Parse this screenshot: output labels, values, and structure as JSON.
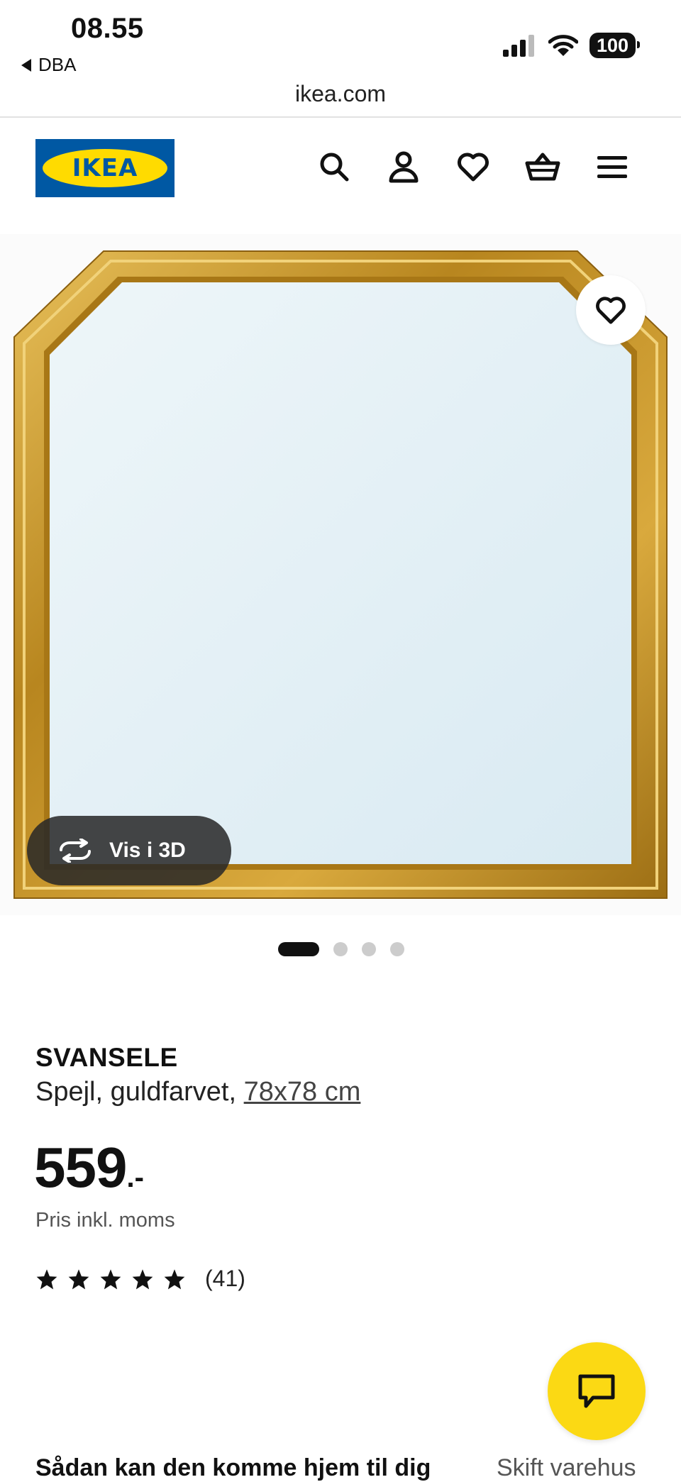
{
  "status_bar": {
    "time": "08.55",
    "back_app": "DBA",
    "battery": "100"
  },
  "browser": {
    "url": "ikea.com"
  },
  "header": {
    "logo_text": "IKEA",
    "icons": [
      "search-icon",
      "account-icon",
      "heart-icon",
      "basket-icon",
      "menu-icon"
    ]
  },
  "gallery": {
    "vis3d_label": "Vis i 3D",
    "image_count": 4,
    "active_index": 0
  },
  "product": {
    "name": "SVANSELE",
    "description": "Spejl, guldfarvet,",
    "size": "78x78 cm",
    "price_int": "559",
    "price_suffix": ".-",
    "price_note": "Pris inkl. moms",
    "rating_stars": 5,
    "review_count": "(41)"
  },
  "delivery": {
    "title": "Sådan kan den komme hjem til dig",
    "change_store": "Skift varehus"
  },
  "colors": {
    "ikea_blue": "#0058a3",
    "ikea_yellow": "#ffdb00",
    "chat_yellow": "#fbd914",
    "gold_frame": "#c9962b",
    "mirror_glass": "#e4f0f5"
  }
}
